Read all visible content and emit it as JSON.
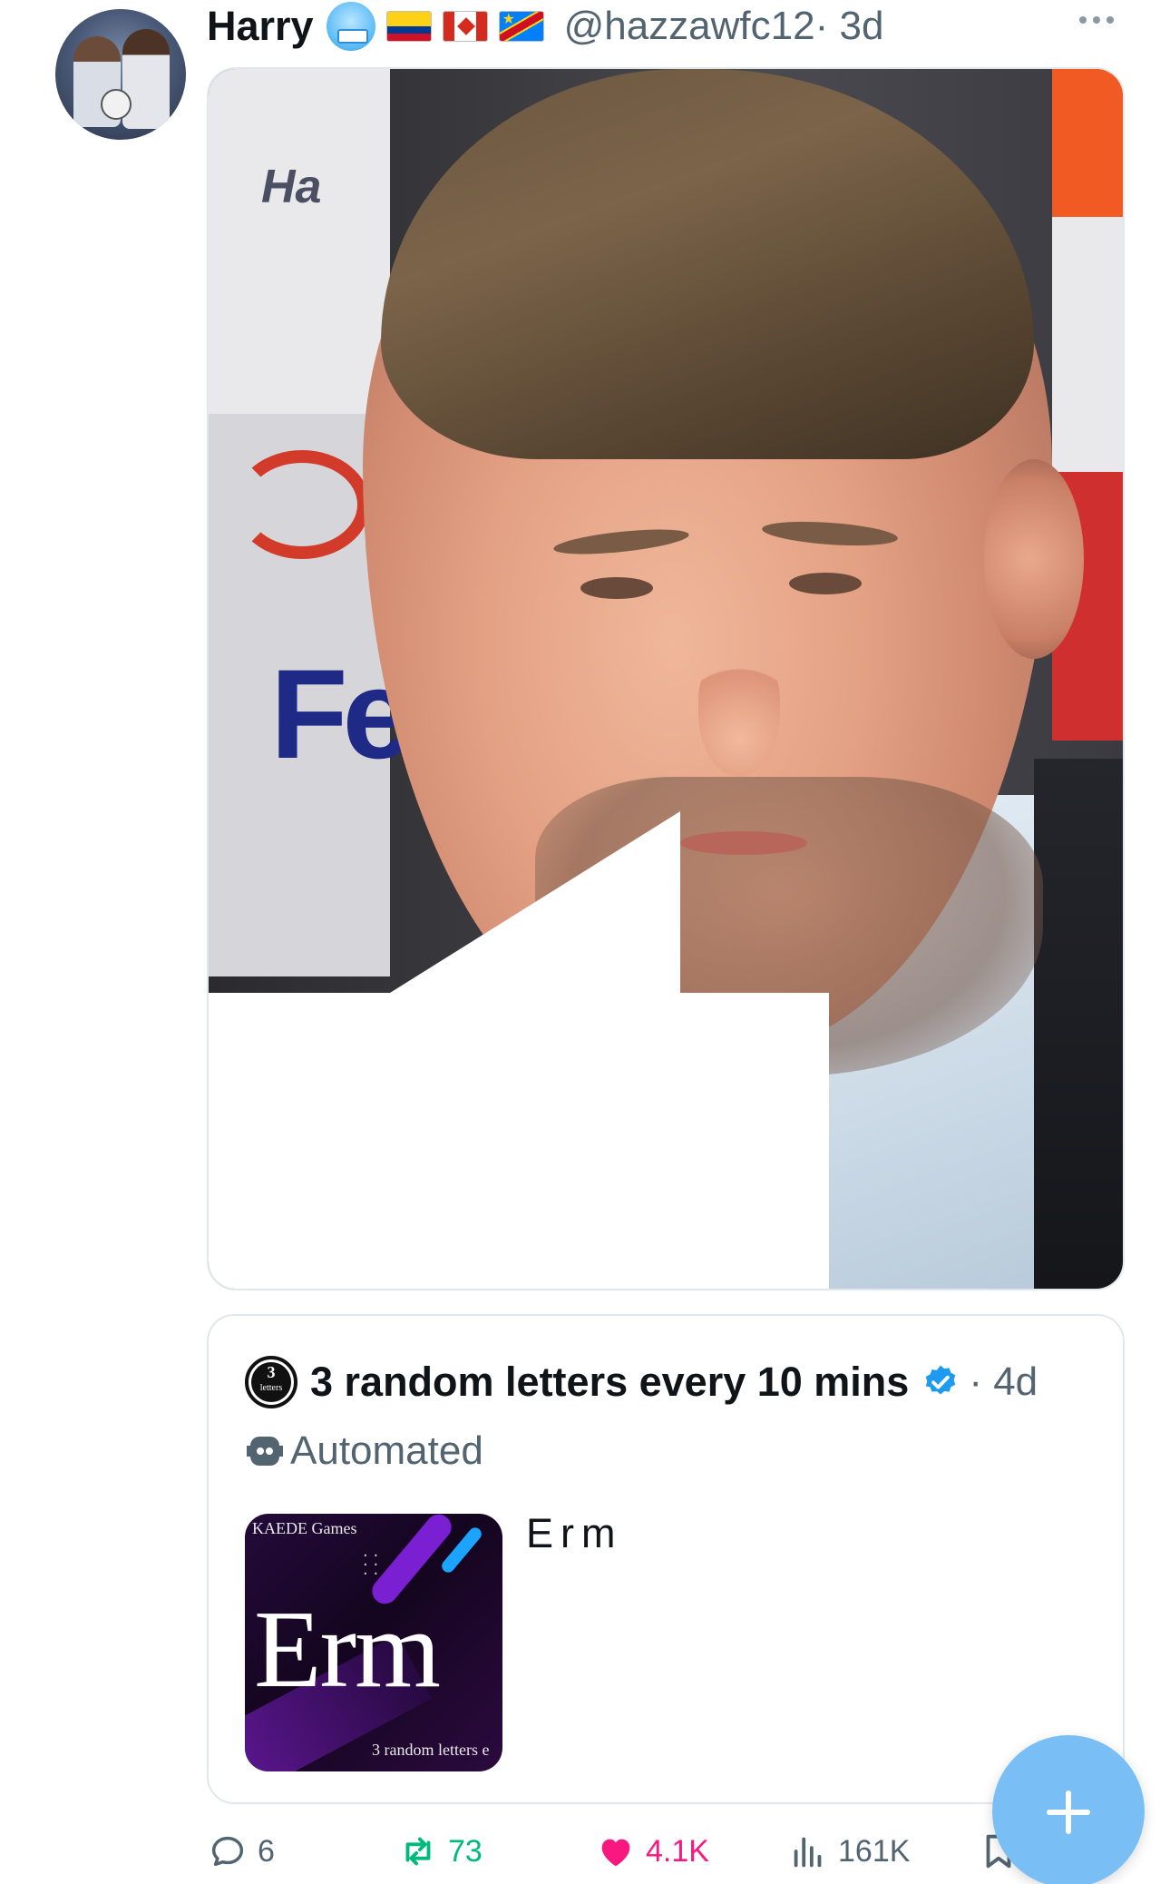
{
  "tweet": {
    "author_name": "Harry",
    "handle": "@hazzawfc12",
    "time": "· 3d",
    "flags": [
      "colombia-flag-icon",
      "canada-flag-icon",
      "dr-congo-flag-icon"
    ],
    "emoji": "cold-face-emoji-icon"
  },
  "quoted": {
    "account_name": "3 random letters every 10 mins",
    "time": "· 4d",
    "automated_label": "Automated",
    "text": "Erm",
    "logo_number": "3",
    "logo_word": "letters",
    "thumb": {
      "brand": "KAEDE Games",
      "big_text": "Erm",
      "caption": "3 random letters e"
    },
    "verified_color": "#1d9bf0"
  },
  "actions": {
    "replies": "6",
    "retweets": "73",
    "likes": "4.1K",
    "views": "161K"
  },
  "colors": {
    "text_secondary": "#536471",
    "retweet": "#00ba7c",
    "like": "#f91880",
    "fab": "#79bff5"
  }
}
